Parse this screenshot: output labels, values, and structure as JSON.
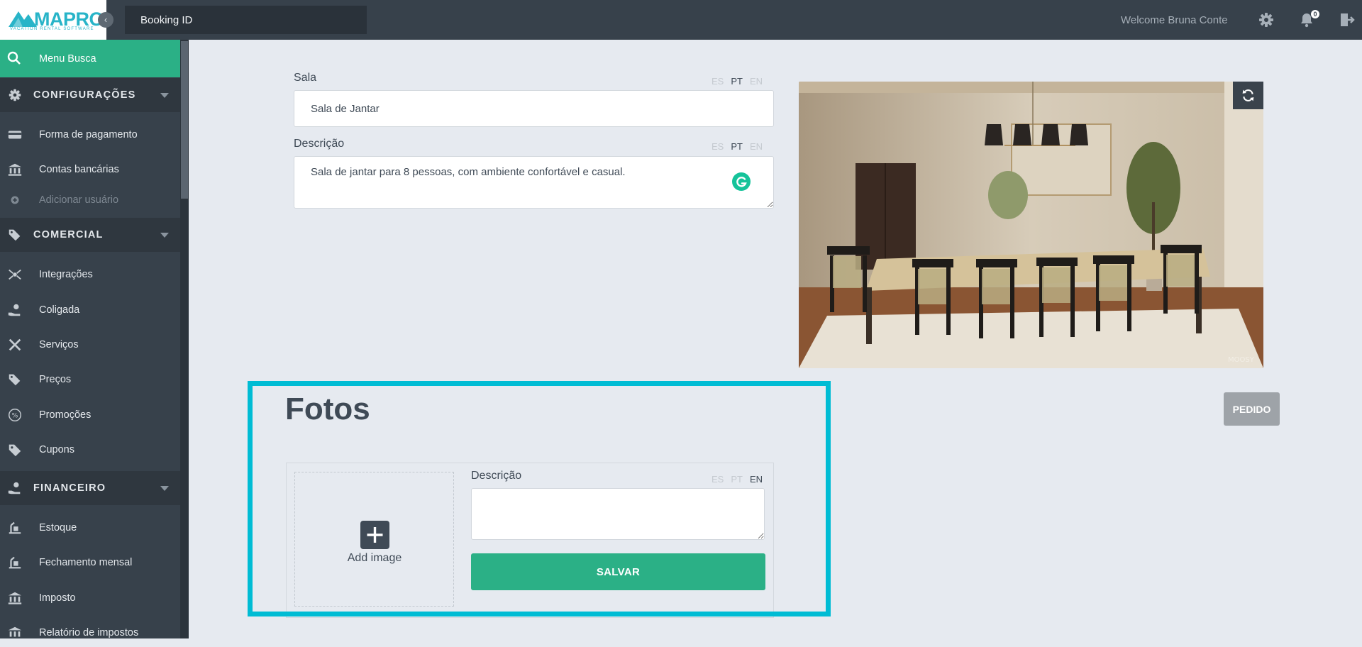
{
  "header": {
    "logo_text": "MAPRO",
    "logo_subtitle": "VACATION RENTAL SOFTWARE",
    "booking_placeholder": "Booking ID",
    "welcome": "Welcome Bruna Conte",
    "notification_count": "0",
    "icons": [
      "gear-icon",
      "bell-icon",
      "logout-icon"
    ]
  },
  "sidebar": {
    "search_label": "Menu Busca",
    "sections": [
      {
        "label": "CONFIGURAÇÕES",
        "icon": "gear-icon",
        "items": [
          {
            "label": "Forma de pagamento",
            "icon": "credit-card-icon"
          },
          {
            "label": "Contas bancárias",
            "icon": "bank-icon"
          },
          {
            "label": "Adicionar usuário",
            "icon": "plus-circle-icon",
            "dimmed": true
          }
        ]
      },
      {
        "label": "COMERCIAL",
        "icon": "tags-icon",
        "items": [
          {
            "label": "Integrações",
            "icon": "integration-icon"
          },
          {
            "label": "Coligada",
            "icon": "hand-money-icon"
          },
          {
            "label": "Serviços",
            "icon": "tools-icon"
          },
          {
            "label": "Preços",
            "icon": "tags-icon"
          },
          {
            "label": "Promoções",
            "icon": "percent-icon"
          },
          {
            "label": "Cupons",
            "icon": "tag-icon"
          }
        ]
      },
      {
        "label": "FINANCEIRO",
        "icon": "hand-money-icon",
        "items": [
          {
            "label": "Estoque",
            "icon": "dolly-icon"
          },
          {
            "label": "Fechamento mensal",
            "icon": "dolly-icon"
          },
          {
            "label": "Imposto",
            "icon": "bank-icon"
          },
          {
            "label": "Relatório de impostos",
            "icon": "bank-icon"
          }
        ]
      }
    ]
  },
  "form": {
    "sala_label": "Sala",
    "sala_value": "Sala de Jantar",
    "descricao_label": "Descrição",
    "descricao_value": "Sala de jantar para 8 pessoas, com ambiente confortável e casual.",
    "languages": [
      "ES",
      "PT",
      "EN"
    ],
    "active_language": "PT"
  },
  "photo": {
    "alt": "Dining room",
    "watermark": "MOOSY"
  },
  "pedido_button": "PEDIDO",
  "fotos": {
    "title": "Fotos",
    "add_image_label": "Add image",
    "descricao_label": "Descrição",
    "active_language": "EN",
    "descricao_value": "",
    "save_button": "SALVAR"
  },
  "colors": {
    "accent": "#2bb086",
    "topbar": "#37414b",
    "highlight": "#00bcd4",
    "background": "#e6eaf0"
  }
}
